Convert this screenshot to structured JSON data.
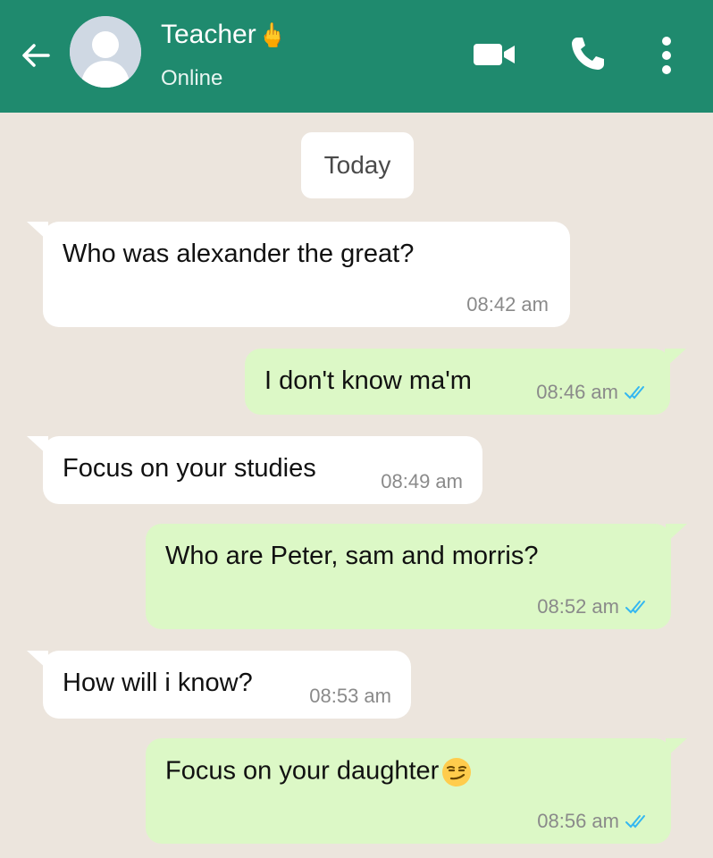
{
  "header": {
    "contact_name": "Teacher",
    "name_emoji": "🖕",
    "status": "Online",
    "colors": {
      "bar": "#1f8a6e",
      "text": "#ffffff"
    },
    "icons": [
      "back-arrow-icon",
      "video-call-icon",
      "phone-call-icon",
      "more-options-icon"
    ]
  },
  "chat": {
    "date_label": "Today",
    "colors": {
      "incoming": "#ffffff",
      "outgoing": "#dcf8c6",
      "background": "#ece5dd",
      "read_ticks": "#34b7f1"
    },
    "messages": [
      {
        "direction": "incoming",
        "text": "Who was alexander the great?",
        "time": "08:42 am"
      },
      {
        "direction": "outgoing",
        "text": "I don't know ma'm",
        "time": "08:46 am",
        "read": true
      },
      {
        "direction": "incoming",
        "text": "Focus on your studies",
        "time": "08:49 am"
      },
      {
        "direction": "outgoing",
        "text": "Who are Peter, sam and morris?",
        "time": "08:52 am",
        "read": true
      },
      {
        "direction": "incoming",
        "text": "How will i know?",
        "time": "08:53 am"
      },
      {
        "direction": "outgoing",
        "text": "Focus on your daughter",
        "emoji": "smirking-face",
        "time": "08:56 am",
        "read": true
      }
    ]
  }
}
